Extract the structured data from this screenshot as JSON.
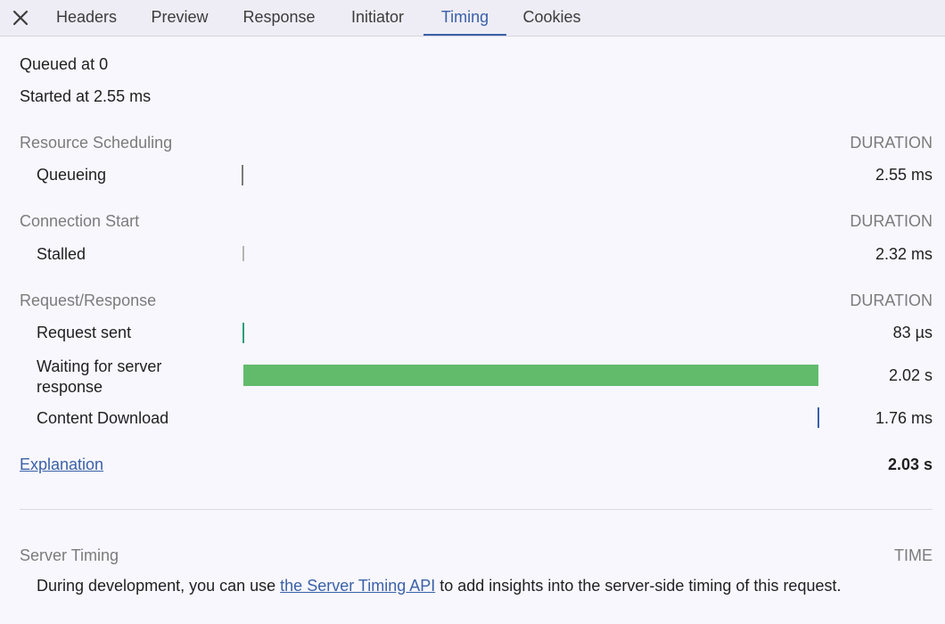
{
  "tabs": {
    "close_label": "✕",
    "items": [
      "Headers",
      "Preview",
      "Response",
      "Initiator",
      "Timing",
      "Cookies"
    ],
    "active": "Timing"
  },
  "queued": "Queued at 0",
  "started": "Started at 2.55 ms",
  "sections": [
    {
      "title": "Resource Scheduling",
      "duration_header": "DURATION",
      "rows": [
        {
          "label": "Queueing",
          "value": "2.55 ms",
          "bar_color": "#7a7a7a"
        }
      ]
    },
    {
      "title": "Connection Start",
      "duration_header": "DURATION",
      "rows": [
        {
          "label": "Stalled",
          "value": "2.32 ms",
          "bar_color": "#b5b5b5"
        }
      ]
    },
    {
      "title": "Request/Response",
      "duration_header": "DURATION",
      "rows": [
        {
          "label": "Request sent",
          "value": "83 µs",
          "bar_color": "#2e9e7c"
        },
        {
          "label": "Waiting for server response",
          "value": "2.02 s",
          "bar_color": "#62bb6b"
        },
        {
          "label": "Content Download",
          "value": "1.76 ms",
          "bar_color": "#3a61a8"
        }
      ]
    }
  ],
  "footer": {
    "explanation_link": "Explanation",
    "total": "2.03 s"
  },
  "server_timing": {
    "title": "Server Timing",
    "time_header": "TIME",
    "text_before": "During development, you can use ",
    "link_text": "the Server Timing API",
    "text_after": " to add insights into the server-side timing of this request."
  }
}
